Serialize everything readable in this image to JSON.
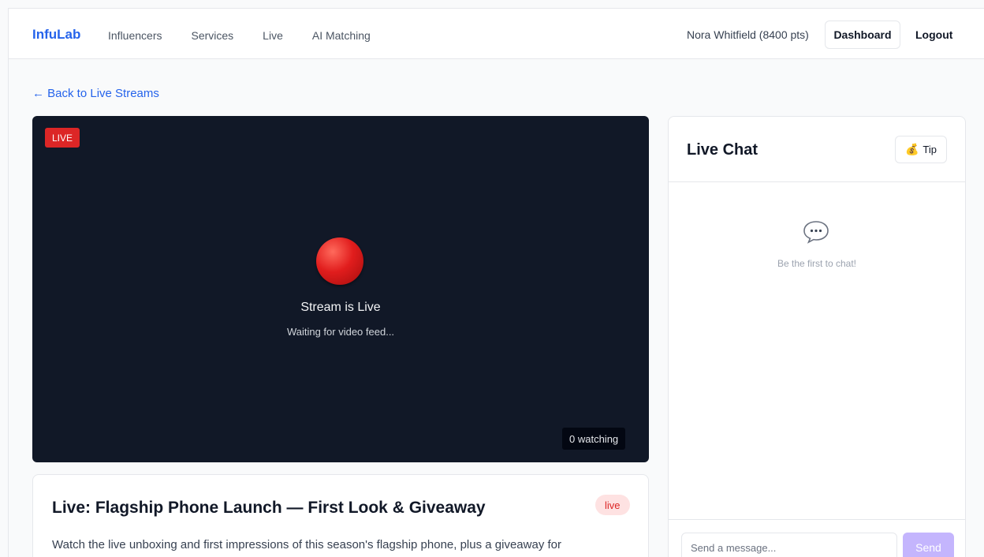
{
  "nav": {
    "brand": "InfuLab",
    "links": [
      "Influencers",
      "Services",
      "Live",
      "AI Matching"
    ],
    "user": "Nora Whitfield (8400 pts)",
    "dashboard_label": "Dashboard",
    "logout_label": "Logout"
  },
  "back_link": "← Back to Live Streams",
  "stream": {
    "live_badge": "LIVE",
    "status_icon": "red-circle-icon",
    "title": "Stream is Live",
    "subtitle": "Waiting for video feed...",
    "viewers": "0 watching"
  },
  "info": {
    "title": "Live: Flagship Phone Launch — First Look & Giveaway",
    "status": "live",
    "description": "Watch the live unboxing and first impressions of this season's flagship phone, plus a giveaway for"
  },
  "chat": {
    "title": "Live Chat",
    "tip_icon": "money-bag-icon",
    "tip_label": "Tip",
    "empty_icon": "speech-bubble-icon",
    "empty_text": "Be the first to chat!",
    "input_placeholder": "Send a message...",
    "send_label": "Send"
  },
  "colors": {
    "accent": "#2563eb",
    "live_red": "#dc2626",
    "send_button": "#c4b5fd",
    "video_bg": "#111827"
  }
}
